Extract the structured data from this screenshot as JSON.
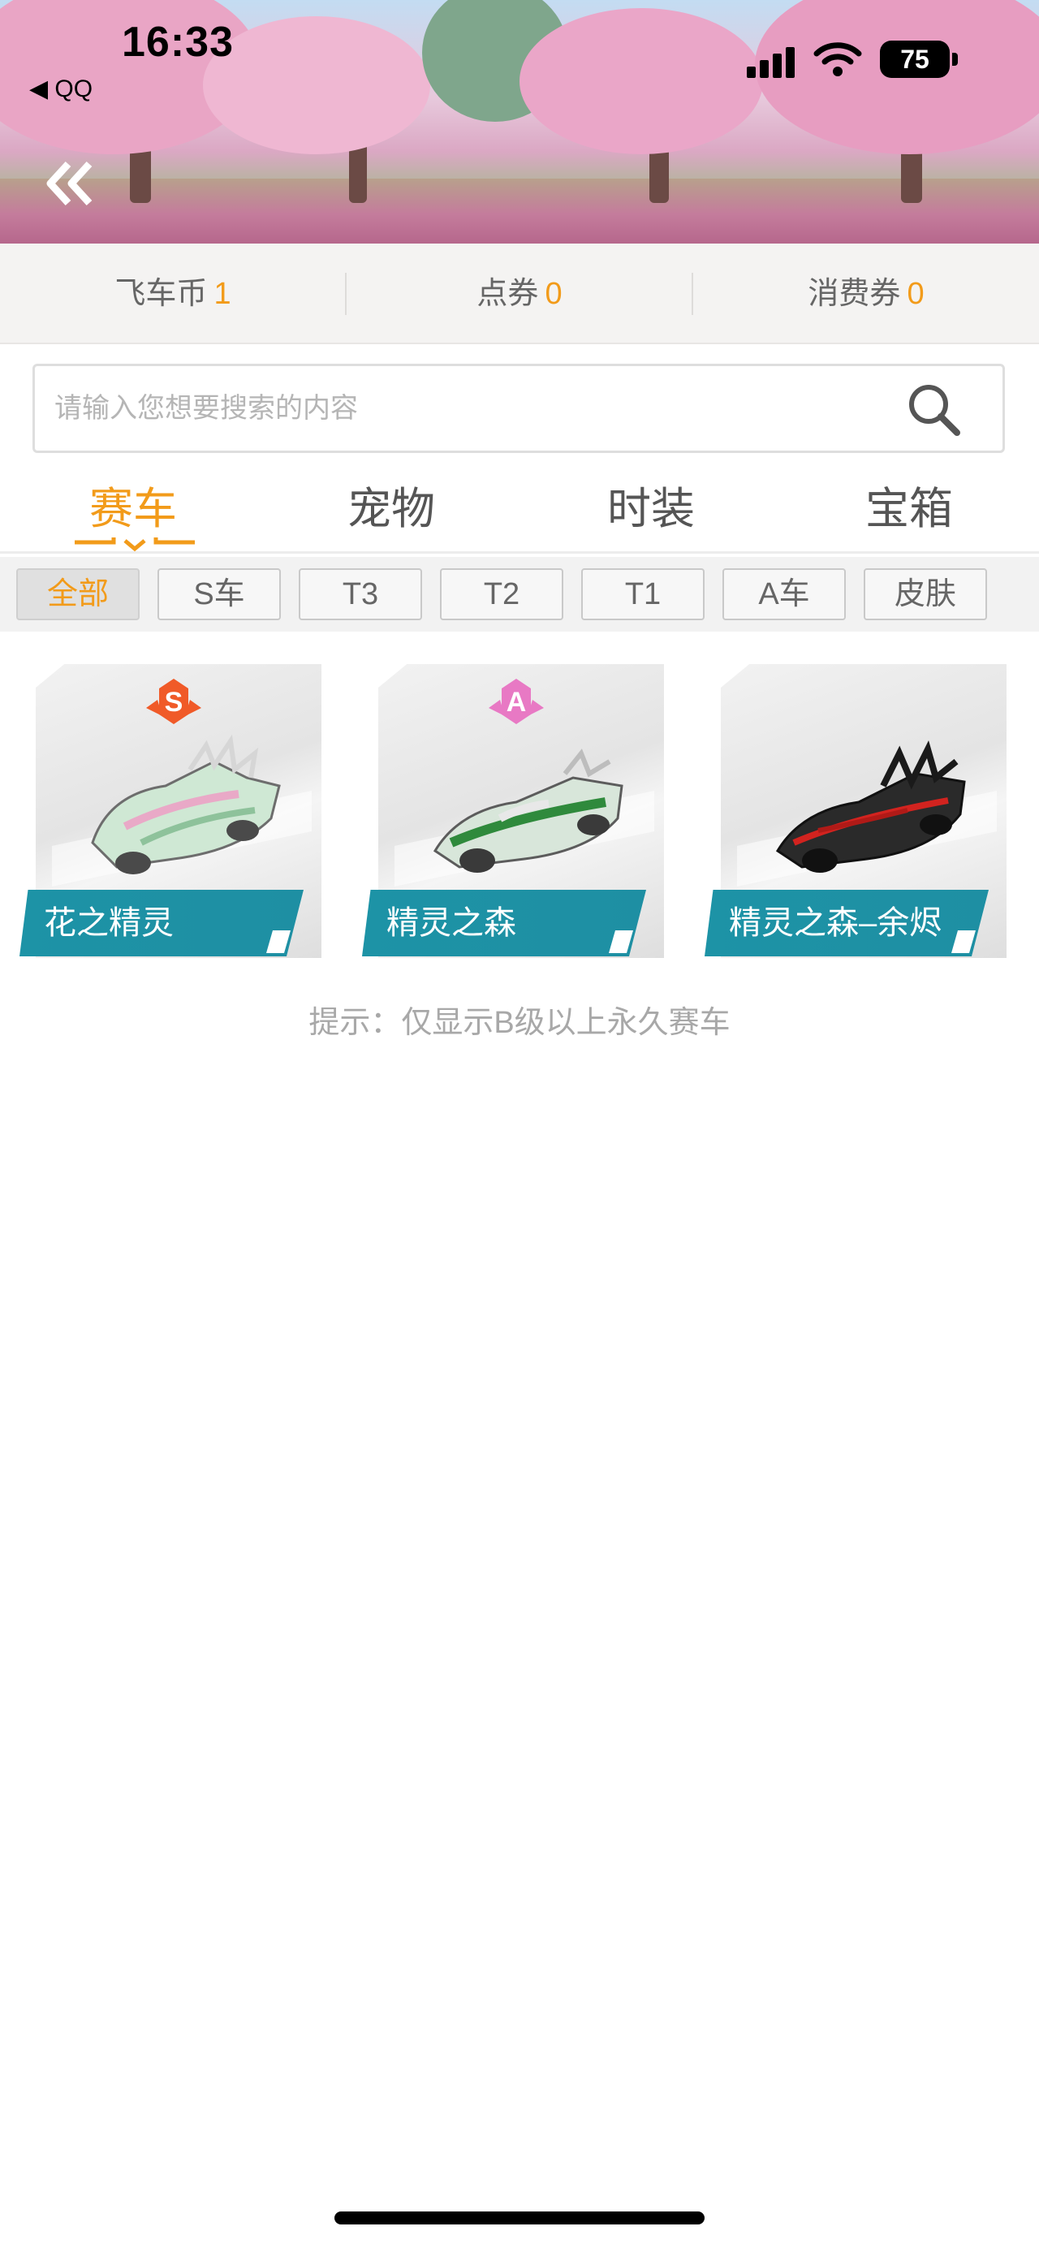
{
  "status_bar": {
    "time": "16:33",
    "back_app": "◀ QQ",
    "battery": "75"
  },
  "header": {
    "back_icon": "double-chevron-left-icon"
  },
  "currency": [
    {
      "label": "飞车币",
      "value": "1"
    },
    {
      "label": "点券",
      "value": "0"
    },
    {
      "label": "消费券",
      "value": "0"
    }
  ],
  "search": {
    "placeholder": "请输入您想要搜索的内容",
    "value": "",
    "icon": "search-icon"
  },
  "tabs": [
    {
      "label": "赛车",
      "active": true
    },
    {
      "label": "宠物",
      "active": false
    },
    {
      "label": "时装",
      "active": false
    },
    {
      "label": "宝箱",
      "active": false
    }
  ],
  "filters": [
    {
      "label": "全部",
      "active": true
    },
    {
      "label": "S车",
      "active": false
    },
    {
      "label": "T3",
      "active": false
    },
    {
      "label": "T2",
      "active": false
    },
    {
      "label": "T1",
      "active": false
    },
    {
      "label": "A车",
      "active": false
    },
    {
      "label": "皮肤",
      "active": false
    }
  ],
  "cars": [
    {
      "name": "花之精灵",
      "rank": "S",
      "rank_color": "#f05a28"
    },
    {
      "name": "精灵之森",
      "rank": "A",
      "rank_color": "#e879c4"
    },
    {
      "name": "精灵之森–余烬",
      "rank": "",
      "rank_color": ""
    }
  ],
  "hint": "提示：仅显示B级以上永久赛车",
  "colors": {
    "accent": "#f29b1a",
    "label_teal": "#1d93a6"
  }
}
